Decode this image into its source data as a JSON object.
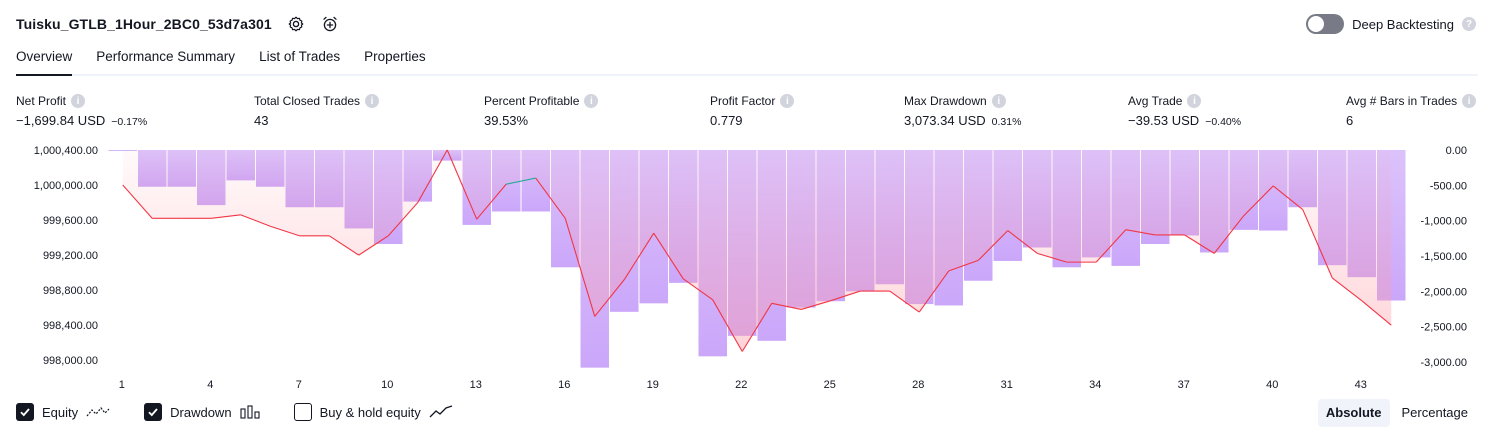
{
  "header": {
    "strategy_name": "Tuisku_GTLB_1Hour_2BC0_53d7a301",
    "deep_backtesting_label": "Deep Backtesting",
    "help_glyph": "?"
  },
  "tabs": [
    {
      "label": "Overview",
      "active": true
    },
    {
      "label": "Performance Summary",
      "active": false
    },
    {
      "label": "List of Trades",
      "active": false
    },
    {
      "label": "Properties",
      "active": false
    }
  ],
  "metrics": [
    {
      "label": "Net Profit",
      "value": "−1,699.84 USD",
      "pct": "−0.17%",
      "color": "#f23645"
    },
    {
      "label": "Total Closed Trades",
      "value": "43",
      "pct": "",
      "color": "#131722"
    },
    {
      "label": "Percent Profitable",
      "value": "39.53%",
      "pct": "",
      "color": "#089981"
    },
    {
      "label": "Profit Factor",
      "value": "0.779",
      "pct": "",
      "color": "#f23645"
    },
    {
      "label": "Max Drawdown",
      "value": "3,073.34 USD",
      "pct": "0.31%",
      "color": "#f23645"
    },
    {
      "label": "Avg Trade",
      "value": "−39.53 USD",
      "pct": "−0.40%",
      "color": "#f23645"
    },
    {
      "label": "Avg # Bars in Trades",
      "value": "6",
      "pct": "",
      "color": "#131722"
    }
  ],
  "legend": {
    "equity_label": "Equity",
    "drawdown_label": "Drawdown",
    "buyhold_label": "Buy & hold equity",
    "equity_checked": true,
    "drawdown_checked": true,
    "buyhold_checked": false
  },
  "modes": {
    "absolute_label": "Absolute",
    "percentage_label": "Percentage",
    "active": "Absolute"
  },
  "chart_data": {
    "type": "line",
    "left_axis_ticks": [
      "1,000,400.00",
      "1,000,000.00",
      "999,600.00",
      "999,200.00",
      "998,800.00",
      "998,400.00",
      "998,000.00"
    ],
    "left_axis_values": [
      1000400,
      1000000,
      999600,
      999200,
      998800,
      998400,
      998000
    ],
    "right_axis_ticks": [
      "0.00",
      "-500.00",
      "-1,000.00",
      "-1,500.00",
      "-2,000.00",
      "-2,500.00",
      "-3,000.00"
    ],
    "right_axis_values": [
      0,
      -500,
      -1000,
      -1500,
      -2000,
      -2500,
      -3000
    ],
    "x_ticks": [
      "1",
      "4",
      "7",
      "10",
      "13",
      "16",
      "19",
      "22",
      "25",
      "28",
      "31",
      "34",
      "37",
      "40",
      "43"
    ],
    "ylim_equity": [
      997980,
      1000400
    ],
    "ylim_drawdown": [
      -3000,
      0
    ],
    "series": [
      {
        "name": "Equity",
        "color": "#f23645",
        "x": [
          1,
          2,
          3,
          4,
          5,
          6,
          7,
          8,
          9,
          10,
          11,
          12,
          13,
          14,
          15,
          16,
          17,
          18,
          19,
          20,
          21,
          22,
          23,
          24,
          25,
          26,
          27,
          28,
          29,
          30,
          31,
          32,
          33,
          34,
          35,
          36,
          37,
          38,
          39,
          40,
          41,
          42,
          43,
          44
        ],
        "values": [
          1000000,
          999620,
          999620,
          999620,
          999660,
          999530,
          999420,
          999420,
          999200,
          999420,
          999800,
          1000400,
          999610,
          1000010,
          1000080,
          999620,
          998500,
          998920,
          999450,
          998930,
          998690,
          998100,
          998650,
          998580,
          998680,
          998790,
          998790,
          998550,
          999020,
          999140,
          999480,
          999220,
          999120,
          999120,
          999490,
          999430,
          999430,
          999220,
          999650,
          999990,
          999720,
          998940,
          998680,
          998400
        ]
      },
      {
        "name": "Drawdown",
        "color": "#c49bfa",
        "x": [
          1,
          2,
          3,
          4,
          5,
          6,
          7,
          8,
          9,
          10,
          11,
          12,
          13,
          14,
          15,
          16,
          17,
          18,
          19,
          20,
          21,
          22,
          23,
          24,
          25,
          26,
          27,
          28,
          29,
          30,
          31,
          32,
          33,
          34,
          35,
          36,
          37,
          38,
          39,
          40,
          41,
          42,
          43,
          44
        ],
        "values": [
          -10,
          -520,
          -520,
          -780,
          -430,
          -520,
          -810,
          -810,
          -1110,
          -1330,
          -730,
          -150,
          -1060,
          -870,
          -870,
          -1660,
          -3080,
          -2290,
          -2170,
          -1880,
          -2920,
          -2630,
          -2700,
          -2230,
          -2140,
          -2000,
          -1900,
          -2180,
          -2200,
          -1850,
          -1570,
          -1380,
          -1660,
          -1520,
          -1640,
          -1330,
          -1210,
          -1450,
          -1130,
          -1140,
          -810,
          -1630,
          -1800,
          -2130
        ]
      }
    ]
  }
}
